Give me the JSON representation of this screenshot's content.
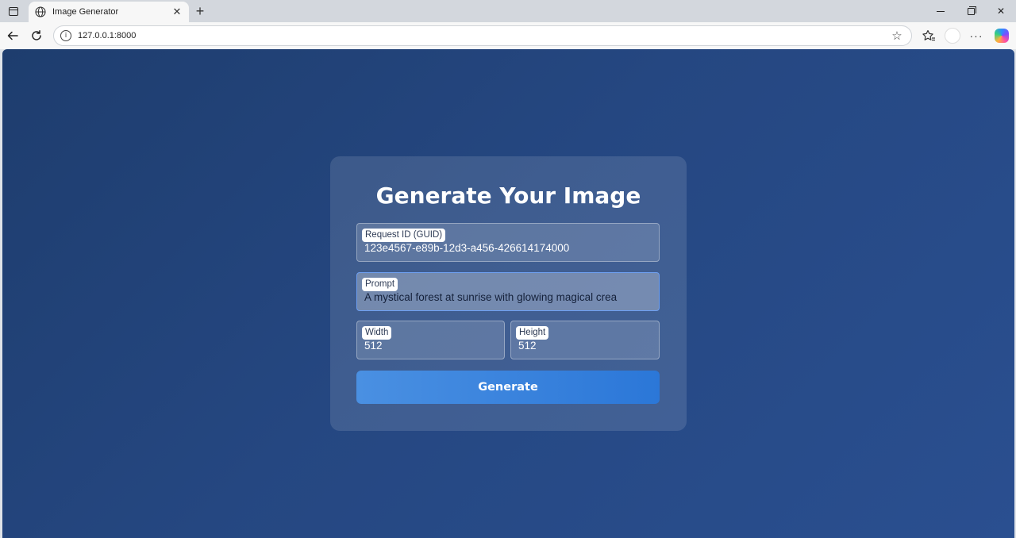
{
  "browser": {
    "tab": {
      "title": "Image Generator",
      "icon": "globe-icon"
    },
    "address_bar": {
      "url": "127.0.0.1:8000"
    }
  },
  "page": {
    "title": "Generate Your Image",
    "fields": {
      "request_id": {
        "label": "Request ID (GUID)",
        "value": "123e4567-e89b-12d3-a456-426614174000"
      },
      "prompt": {
        "label": "Prompt",
        "value": "A mystical forest at sunrise with glowing magical crea"
      },
      "width": {
        "label": "Width",
        "value": "512"
      },
      "height": {
        "label": "Height",
        "value": "512"
      }
    },
    "generate_label": "Generate"
  },
  "colors": {
    "background_start": "#1e3d6e",
    "background_end": "#2a4f90",
    "button": "#3a87e0"
  }
}
